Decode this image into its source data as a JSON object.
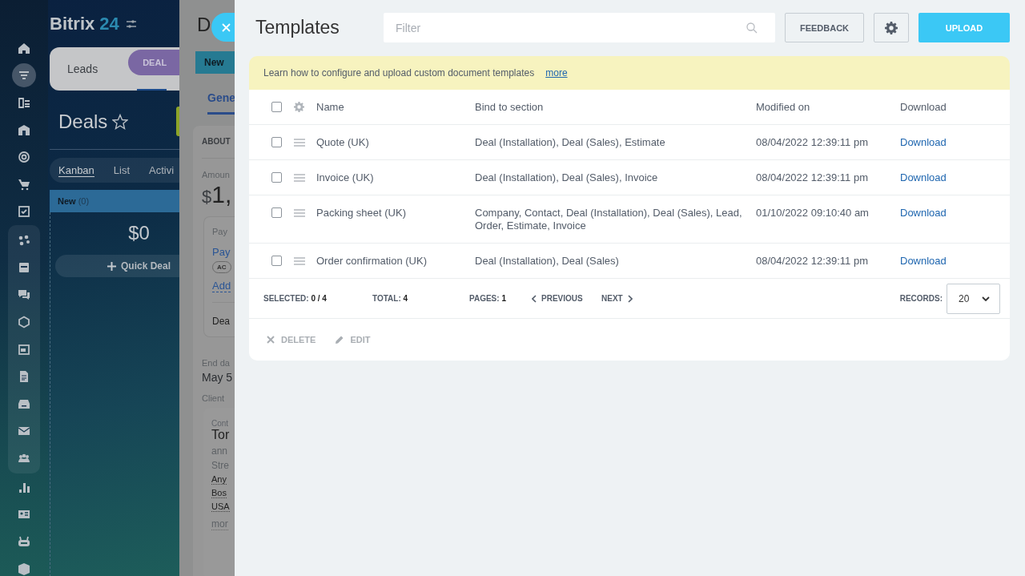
{
  "sidebar": {
    "sections": [
      {
        "grouped": false,
        "items": [
          {
            "selected": false
          },
          {
            "selected": true
          },
          {
            "selected": false
          },
          {
            "selected": false
          },
          {
            "selected": false
          },
          {
            "selected": false
          },
          {
            "selected": false
          }
        ]
      },
      {
        "grouped": true,
        "items": [
          {
            "selected": false
          },
          {
            "selected": false
          },
          {
            "selected": false
          },
          {
            "selected": false
          },
          {
            "selected": false
          },
          {
            "selected": false
          },
          {
            "selected": false
          },
          {
            "selected": false
          },
          {
            "selected": false
          }
        ]
      },
      {
        "grouped": false,
        "items": [
          {
            "selected": false
          },
          {
            "selected": false
          },
          {
            "selected": false
          },
          {
            "selected": false
          }
        ]
      }
    ]
  },
  "crm": {
    "logo": {
      "name": "Bitrix",
      "number": "24"
    },
    "tabs": [
      {
        "label": "Leads",
        "selected": false
      },
      {
        "label": "DEAL",
        "selected": true
      }
    ],
    "title": "Deals",
    "views": [
      {
        "label": "Kanban",
        "selected": true
      },
      {
        "label": "List",
        "selected": false
      },
      {
        "label": "Activi",
        "selected": false
      }
    ],
    "column": {
      "title": "New",
      "count": "(0)",
      "sum": "$0",
      "quick_add": "Quick Deal"
    }
  },
  "deal": {
    "title": "D",
    "stage": "New",
    "tab": "Gene",
    "section": "ABOUT",
    "amount_label": "Amoun",
    "currency": "$",
    "amount": "1,",
    "payment": {
      "label": "Pay",
      "link": "Pay",
      "badge": "AC",
      "add": "Add",
      "footer": "Dea"
    },
    "end_label": "End da",
    "end_value": "May 5",
    "client_label": "Client",
    "contact": {
      "label": "Cont",
      "name": "Tor",
      "email": "ann",
      "street_label": "Stre",
      "lines": [
        "Any",
        "Bos",
        "USA"
      ],
      "more": "mor"
    }
  },
  "templates": {
    "title": "Templates",
    "filter": {
      "placeholder": "Filter"
    },
    "buttons": [
      {
        "kind": "secondary",
        "label": "FEEDBACK"
      },
      {
        "kind": "settings"
      },
      {
        "kind": "primary",
        "label": "UPLOAD"
      }
    ],
    "banner": {
      "text": "Learn how to configure and upload custom document templates",
      "link": "more"
    },
    "table": {
      "select_all": {
        "checked": false
      },
      "columns": [
        "Name",
        "Bind to section",
        "Modified on",
        "Download"
      ],
      "rows": [
        {
          "checked": false,
          "name": "Quote (UK)",
          "bind": "Deal (Installation), Deal (Sales), Estimate",
          "modified": "08/04/2022 12:39:11 pm",
          "download": "Download"
        },
        {
          "checked": false,
          "name": "Invoice (UK)",
          "bind": "Deal (Installation), Deal (Sales), Invoice",
          "modified": "08/04/2022 12:39:11 pm",
          "download": "Download"
        },
        {
          "checked": false,
          "name": "Packing sheet (UK)",
          "bind": "Company, Contact, Deal (Installation), Deal (Sales), Lead, Order, Estimate, Invoice",
          "modified": "01/10/2022 09:10:40 am",
          "download": "Download"
        },
        {
          "checked": false,
          "name": "Order confirmation (UK)",
          "bind": "Deal (Installation), Deal (Sales)",
          "modified": "08/04/2022 12:39:11 pm",
          "download": "Download"
        }
      ]
    },
    "footer": {
      "selected_label": "SELECTED:",
      "selected": "0 / 4",
      "total_label": "TOTAL:",
      "total": "4",
      "pages_label": "PAGES:",
      "pages": "1",
      "previous": "PREVIOUS",
      "next": "NEXT",
      "records_label": "RECORDS:",
      "records": "20"
    },
    "actions": [
      {
        "kind": "delete",
        "label": "DELETE",
        "disabled": true
      },
      {
        "kind": "edit",
        "label": "EDIT",
        "disabled": true
      }
    ]
  }
}
